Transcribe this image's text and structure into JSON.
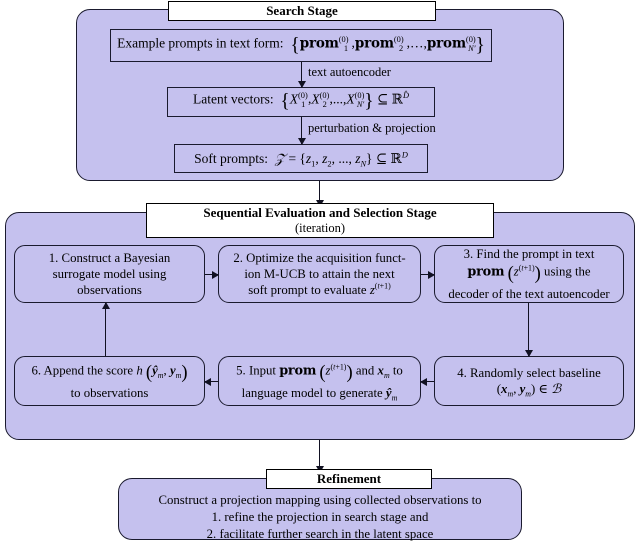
{
  "diagram": {
    "title_implicit": "Prompt search, sequential evaluation and refinement pipeline",
    "fill_color": "#c5c1ee",
    "line_color": "#1a1a2e"
  },
  "search_stage": {
    "header": "Search Stage",
    "box_prompts_prefix": "Example prompts in text form:",
    "box_prompts_set": "{ prom_1^(0), prom_2^(0), ..., prom_N'^(0) }",
    "edge_label_autoencoder": "text autoencoder",
    "box_latent_prefix": "Latent vectors:",
    "box_latent_set": "{ X_1^(0), X_2^(0), ..., X_N'^(0) } ⊆ ℝ^D̂",
    "edge_label_perturbation": "perturbation & projection",
    "box_soft_prefix": "Soft prompts:",
    "box_soft_set": "𝒵 = {z_1, z_2, ..., z_N} ⊆ ℝ^D"
  },
  "eval_stage": {
    "header_line1": "Sequential Evaluation and Selection Stage",
    "header_line2": "(iteration)",
    "steps": [
      {
        "number": "1.",
        "text_line1": "Construct a Bayesian",
        "text_line2": "surrogate model using",
        "text_line3": "observations"
      },
      {
        "number": "2.",
        "text_line1": "Optimize the acquisition funct-",
        "text_line2": "ion M-UCB to attain the next",
        "text_line3": "soft prompt to evaluate z^(t+1)"
      },
      {
        "number": "3.",
        "text_line1": "Find the prompt in text",
        "text_line2": "prom ( z^(t+1) ) using the",
        "text_line3": "decoder of the text autoencoder"
      },
      {
        "number": "4.",
        "text_line1": "Randomly select baseline",
        "text_line2": "( x_m , y_m ) ∈ ℬ"
      },
      {
        "number": "5.",
        "text_line1": "Input prom ( z^(t+1) ) and x_m to",
        "text_line2": "language model to generate ŷ_m"
      },
      {
        "number": "6.",
        "text_line1": "Append the score h ( ŷ_m , y_m )",
        "text_line2": "to observations"
      }
    ]
  },
  "refinement_stage": {
    "header": "Refinement",
    "line1": "Construct a projection mapping using collected observations to",
    "line2": "1. refine the projection in search stage and",
    "line3": "2. facilitate further search in the latent space"
  }
}
